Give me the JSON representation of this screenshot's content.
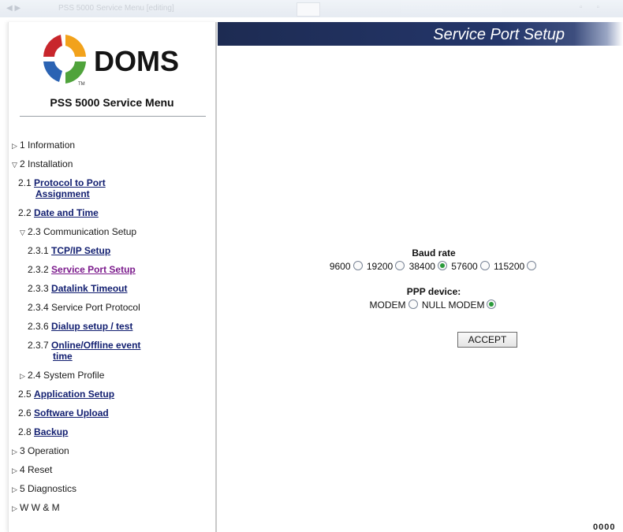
{
  "window": {
    "title": "PSS 5000 Service Menu [editing]"
  },
  "brand": {
    "name": "DOMS",
    "menu_title": "PSS 5000 Service Menu",
    "colors": {
      "red": "#c8262c",
      "blue": "#2b63b3",
      "green": "#4fa33b",
      "navy": "#1d2b52"
    }
  },
  "nav": {
    "information": "1 Information",
    "installation": "2 Installation",
    "protocol_prefix": "2.1",
    "protocol_link_1": "Protocol to Port",
    "protocol_link_2": "Assignment",
    "date_prefix": "2.2",
    "date_link": "Date and Time",
    "comm_setup": "2.3 Communication Setup",
    "tcpip_prefix": "2.3.1",
    "tcpip_link": "TCP/IP Setup",
    "service_port_prefix": "2.3.2",
    "service_port_link": "Service Port Setup",
    "datalink_prefix": "2.3.3",
    "datalink_link": "Datalink Timeout",
    "service_protocol": "2.3.4 Service Port Protocol",
    "dialup_prefix": "2.3.6",
    "dialup_link": "Dialup setup / test",
    "online_prefix": "2.3.7",
    "online_link_1": "Online/Offline event",
    "online_link_2": "time",
    "system_profile": "2.4 System Profile",
    "app_prefix": "2.5",
    "app_link": "Application Setup",
    "software_prefix": "2.6",
    "software_link": "Software Upload",
    "backup_prefix": "2.8",
    "backup_link": "Backup",
    "operation": "3 Operation",
    "reset": "4 Reset",
    "diagnostics": "5 Diagnostics",
    "wwm": "W W & M"
  },
  "page": {
    "title": "Service Port Setup",
    "baud_label": "Baud rate",
    "baud_options": [
      "9600",
      "19200",
      "38400",
      "57600",
      "115200"
    ],
    "baud_selected": "38400",
    "ppp_label": "PPP device:",
    "ppp_options": [
      "MODEM",
      "NULL MODEM"
    ],
    "ppp_selected": "NULL MODEM",
    "accept_label": "ACCEPT",
    "corner_text": "0000"
  }
}
